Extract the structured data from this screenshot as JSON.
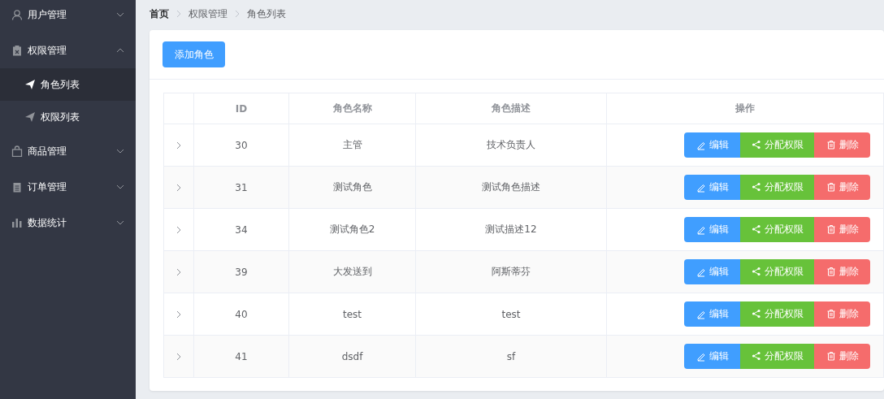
{
  "sidebar": {
    "items": [
      {
        "label": "用户管理",
        "expanded": false
      },
      {
        "label": "权限管理",
        "expanded": true,
        "children": [
          {
            "label": "角色列表",
            "selected": true
          },
          {
            "label": "权限列表",
            "selected": false
          }
        ]
      },
      {
        "label": "商品管理",
        "expanded": false
      },
      {
        "label": "订单管理",
        "expanded": false
      },
      {
        "label": "数据统计",
        "expanded": false
      }
    ]
  },
  "breadcrumb": [
    "首页",
    "权限管理",
    "角色列表"
  ],
  "add_button": "添加角色",
  "table": {
    "columns": [
      "ID",
      "角色名称",
      "角色描述",
      "操作"
    ],
    "rows": [
      {
        "id": "30",
        "name": "主管",
        "description": "技术负责人",
        "expanded": false,
        "actions": [
          "编辑",
          "分配权限",
          "删除"
        ]
      },
      {
        "id": "31",
        "name": "测试角色",
        "description": "测试角色描述",
        "expanded": false,
        "actions": [
          "编辑",
          "分配权限",
          "删除"
        ]
      },
      {
        "id": "34",
        "name": "测试角色2",
        "description": "测试描述12",
        "expanded": false,
        "actions": [
          "编辑",
          "分配权限",
          "删除"
        ]
      },
      {
        "id": "39",
        "name": "大发送到",
        "description": "阿斯蒂芬",
        "expanded": false,
        "actions": [
          "编辑",
          "分配权限",
          "删除"
        ]
      },
      {
        "id": "40",
        "name": "test",
        "description": "test",
        "expanded": false,
        "actions": [
          "编辑",
          "分配权限",
          "删除"
        ]
      },
      {
        "id": "41",
        "name": "dsdf",
        "description": "sf",
        "expanded": false,
        "actions": [
          "编辑",
          "分配权限",
          "删除"
        ]
      }
    ]
  }
}
